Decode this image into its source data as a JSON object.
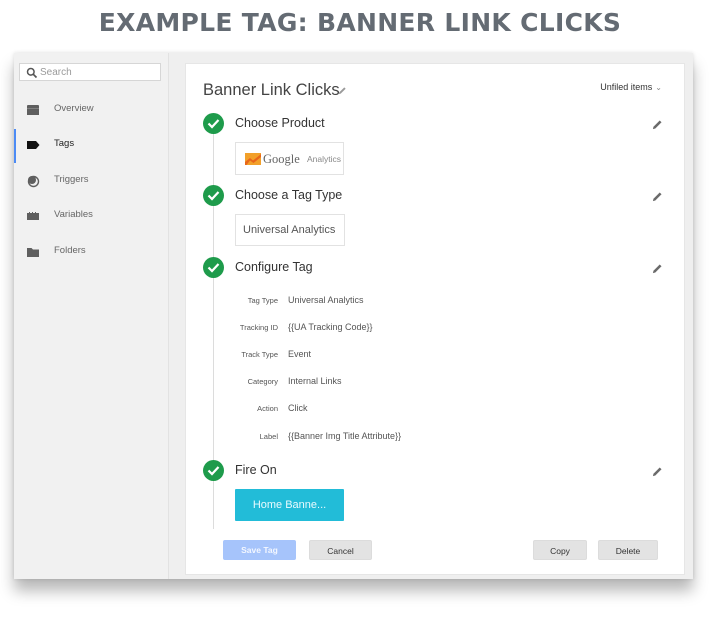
{
  "banner": {
    "title": "EXAMPLE TAG: BANNER LINK CLICKS"
  },
  "sidebar": {
    "search_placeholder": "Search",
    "items": [
      {
        "label": "Overview",
        "icon": "overview-icon",
        "active": false
      },
      {
        "label": "Tags",
        "icon": "tag-icon",
        "active": true
      },
      {
        "label": "Triggers",
        "icon": "trigger-icon",
        "active": false
      },
      {
        "label": "Variables",
        "icon": "variables-icon",
        "active": false
      },
      {
        "label": "Folders",
        "icon": "folder-icon",
        "active": false
      }
    ]
  },
  "tag": {
    "name": "Banner Link Clicks",
    "folder_selector": "Unfiled items",
    "steps": [
      {
        "title": "Choose Product",
        "status": "complete"
      },
      {
        "title": "Choose a Tag Type",
        "status": "complete"
      },
      {
        "title": "Configure Tag",
        "status": "complete"
      },
      {
        "title": "Fire On",
        "status": "complete"
      }
    ],
    "product": {
      "brand": "Google",
      "name": "Analytics"
    },
    "tag_type": "Universal Analytics",
    "configuration": [
      {
        "label": "Tag Type",
        "value": "Universal Analytics"
      },
      {
        "label": "Tracking ID",
        "value": "{{UA Tracking Code}}"
      },
      {
        "label": "Track Type",
        "value": "Event"
      },
      {
        "label": "Category",
        "value": "Internal Links"
      },
      {
        "label": "Action",
        "value": "Click"
      },
      {
        "label": "Label",
        "value": "{{Banner Img Title Attribute}}"
      }
    ],
    "trigger": "Home Banne..."
  },
  "actions": {
    "save": "Save Tag",
    "cancel": "Cancel",
    "copy": "Copy",
    "delete": "Delete"
  },
  "colors": {
    "accent": "#4c8bf5",
    "check_green": "#1e9b4b",
    "trigger_chip": "#22bcd8",
    "save_disabled": "#a6c4fb",
    "banner_text": "#646b73"
  }
}
